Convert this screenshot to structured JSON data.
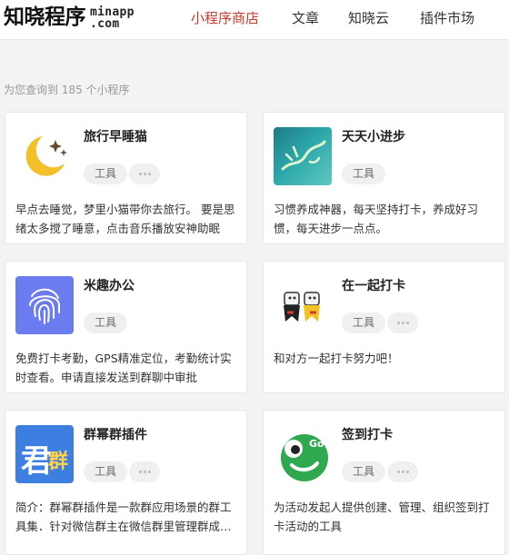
{
  "header": {
    "logo_cn": "知晓程序",
    "logo_en_line1": "minapp",
    "logo_en_line2": ".com",
    "nav": [
      "小程序商店",
      "文章",
      "知晓云",
      "插件市场"
    ],
    "active_nav": "小程序商店",
    "accent_color": "#c8382c"
  },
  "result_count": "为您查询到 185 个小程序",
  "apps": [
    {
      "name": "旅行早睡猫",
      "tag": "工具",
      "icon": "moon-stars-icon",
      "desc": "早点去睡觉，梦里小猫带你去旅行。 要是思绪太多搅了睡意，点击音乐播放安神助眠"
    },
    {
      "name": "天天小进步",
      "tag": "工具",
      "icon": "calligraphy-icon",
      "desc": "习惯养成神器，每天坚持打卡，养成好习惯，每天进步一点点。"
    },
    {
      "name": "米趣办公",
      "tag": "工具",
      "icon": "fingerprint-icon",
      "desc": "免费打卡考勤，GPS精准定位，考勤统计实时查看。申请直接发送到群聊中审批"
    },
    {
      "name": "在一起打卡",
      "tag": "工具",
      "icon": "couple-icon",
      "desc": "和对方一起打卡努力吧！"
    },
    {
      "name": "群幂群插件",
      "tag": "工具",
      "icon": "qunmi-logo-icon",
      "icon_text_main": "君",
      "icon_text_side": "群",
      "desc": "简介：群幂群插件是一款群应用场景的群工具集．针对微信群主在微信群里管理群成员的需求"
    },
    {
      "name": "签到打卡",
      "tag": "工具",
      "icon": "go-frog-icon",
      "icon_text": "Go",
      "desc": "为活动发起人提供创建、管理、组织签到打卡活动的工具"
    }
  ]
}
